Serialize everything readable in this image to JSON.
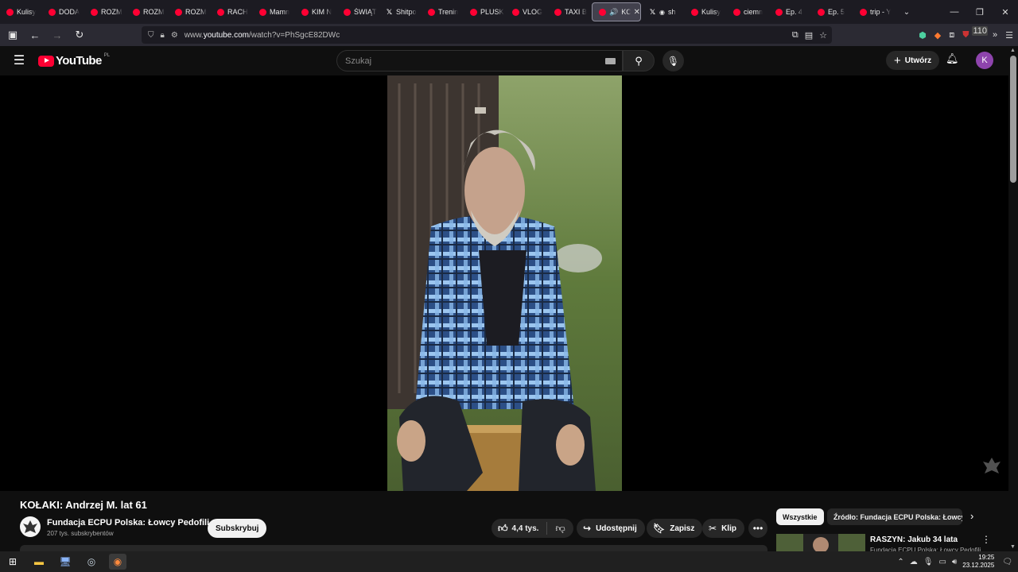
{
  "browser": {
    "tabs": [
      {
        "label": "Kulisy",
        "icon": "youtube-icon"
      },
      {
        "label": "DODA",
        "icon": "youtube-icon"
      },
      {
        "label": "ROZM",
        "icon": "youtube-icon"
      },
      {
        "label": "ROZM",
        "icon": "youtube-icon"
      },
      {
        "label": "ROZM",
        "icon": "youtube-icon"
      },
      {
        "label": "RACH",
        "icon": "youtube-icon"
      },
      {
        "label": "Mamn",
        "icon": "youtube-icon"
      },
      {
        "label": "KIM N",
        "icon": "youtube-icon"
      },
      {
        "label": "ŚWIĄT",
        "icon": "youtube-icon"
      },
      {
        "label": "Shitpo",
        "icon": "x-icon"
      },
      {
        "label": "Trenin",
        "icon": "youtube-icon"
      },
      {
        "label": "PLUSK",
        "icon": "youtube-icon"
      },
      {
        "label": "VLOG",
        "icon": "youtube-icon"
      },
      {
        "label": "TAXI B",
        "icon": "youtube-icon"
      },
      {
        "label": "KO",
        "icon": "youtube-icon",
        "active": true,
        "audio": true
      },
      {
        "label": "sh",
        "icon": "x-icon"
      },
      {
        "label": "Kulisy",
        "icon": "youtube-icon"
      },
      {
        "label": "ciemn",
        "icon": "youtube-icon"
      },
      {
        "label": "Ep. 4",
        "icon": "youtube-icon"
      },
      {
        "label": "Ep. 5",
        "icon": "youtube-icon"
      },
      {
        "label": "trip - Y",
        "icon": "youtube-icon"
      }
    ],
    "url_prefix": "www.",
    "url_host": "youtube.com",
    "url_path": "/watch?v=PhSgcE82DWc",
    "extension_badge": "110"
  },
  "youtube": {
    "logo_text": "YouTube",
    "country_code": "PL",
    "search_placeholder": "Szukaj",
    "create_label": "Utwórz",
    "avatar_letter": "K"
  },
  "video": {
    "title": "KOŁAKI: Andrzej M. lat 61",
    "channel_name": "Fundacja ECPU Polska: Łowcy Pedofili",
    "subscribers": "207 tys. subskrybentów",
    "subscribe_label": "Subskrybuj",
    "likes": "4,4 tys.",
    "share_label": "Udostępnij",
    "save_label": "Zapisz",
    "clip_label": "Klip"
  },
  "sidebar": {
    "chips": [
      "Wszystkie",
      "Źródło: Fundacja ECPU Polska: Łowcy Pedofili"
    ],
    "rec_title": "RASZYN: Jakub 34 lata",
    "rec_channel": "Fundacja ECPU Polska: Łowcy Pedofili"
  },
  "taskbar": {
    "time": "19:25",
    "date": "23.12.2025"
  },
  "colors": {
    "youtube_red": "#ff0033",
    "background": "#0f0f0f",
    "avatar": "#8e44ad"
  }
}
